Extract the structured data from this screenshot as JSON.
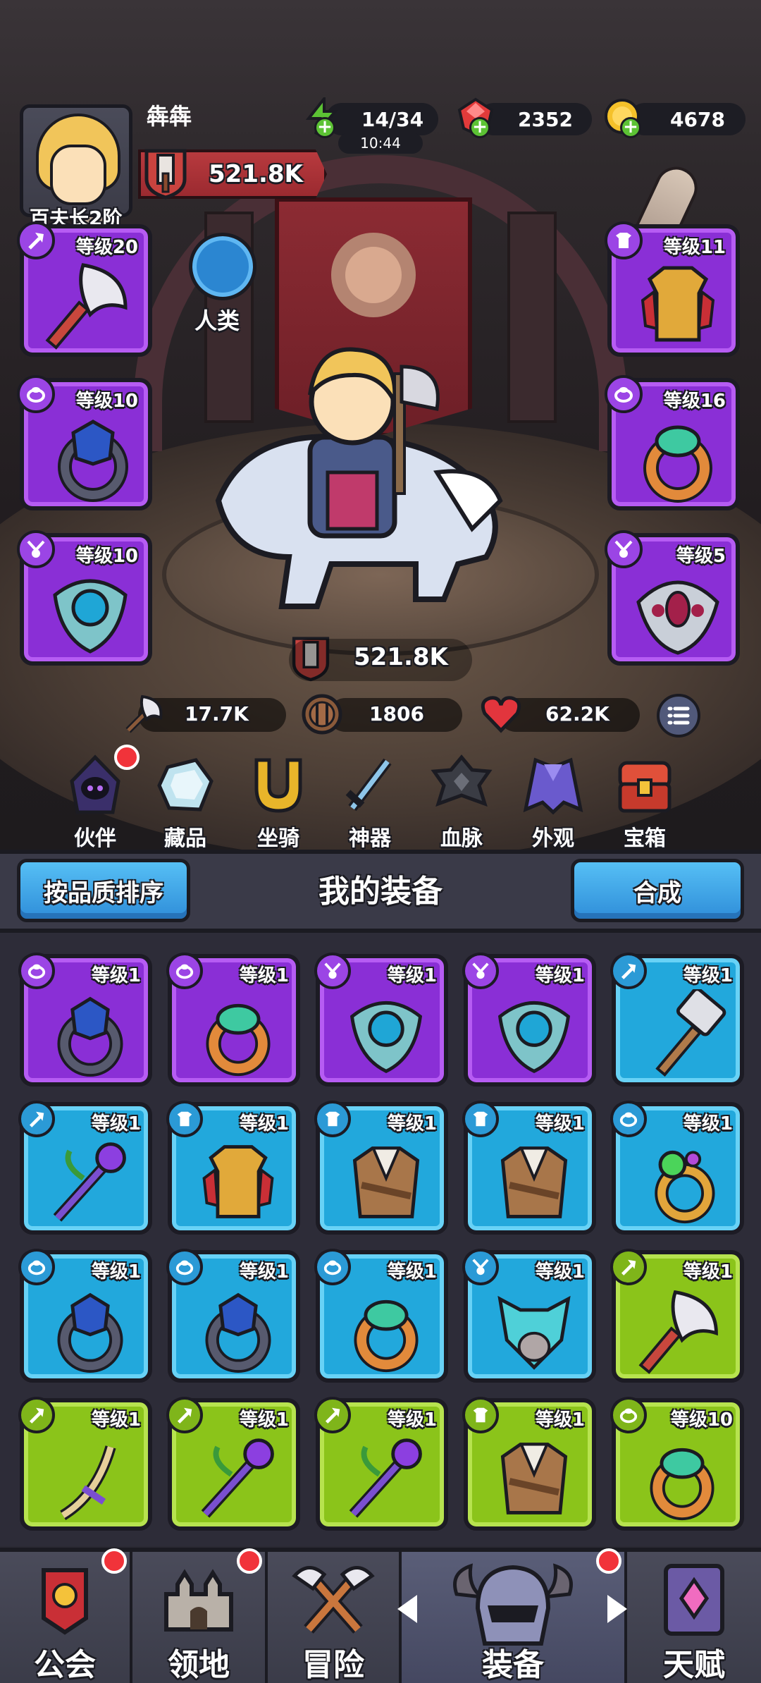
{
  "player": {
    "name": "犇犇",
    "rank": "百夫长2阶",
    "power": "521.8K"
  },
  "resources": {
    "energy": {
      "value": "14/34",
      "timer": "10:44",
      "color": "#5cc234"
    },
    "gems": {
      "value": "2352",
      "color": "#e23a3a"
    },
    "gold": {
      "value": "4678",
      "color": "#f5c12a"
    }
  },
  "race": {
    "label": "人类"
  },
  "equipped": {
    "weapon": {
      "level": "等级20",
      "icon": "axe-icon"
    },
    "armor": {
      "level": "等级11",
      "icon": "armor-icon"
    },
    "ring_left": {
      "level": "等级10",
      "icon": "ring-icon"
    },
    "ring_right": {
      "level": "等级16",
      "icon": "ring-icon"
    },
    "amulet_left": {
      "level": "等级10",
      "icon": "amulet-icon"
    },
    "amulet_right": {
      "level": "等级5",
      "icon": "amulet-icon"
    }
  },
  "hero_power": "521.8K",
  "stats": {
    "attack": "17.7K",
    "defense": "1806",
    "health": "62.2K"
  },
  "features": [
    {
      "label": "伙伴",
      "badge": true
    },
    {
      "label": "藏品",
      "badge": false
    },
    {
      "label": "坐骑",
      "badge": false
    },
    {
      "label": "神器",
      "badge": false
    },
    {
      "label": "血脉",
      "badge": false
    },
    {
      "label": "外观",
      "badge": false
    },
    {
      "label": "宝箱",
      "badge": false
    }
  ],
  "inventory": {
    "sort_label": "按品质排序",
    "title": "我的装备",
    "merge_label": "合成",
    "items": [
      {
        "level": "等级1",
        "rarity": "purple",
        "type": "ring",
        "art": "dark-ring"
      },
      {
        "level": "等级1",
        "rarity": "purple",
        "type": "ring",
        "art": "jade-ring"
      },
      {
        "level": "等级1",
        "rarity": "purple",
        "type": "amulet",
        "art": "blue-amulet"
      },
      {
        "level": "等级1",
        "rarity": "purple",
        "type": "amulet",
        "art": "blue-amulet"
      },
      {
        "level": "等级1",
        "rarity": "blue",
        "type": "weapon",
        "art": "hammer"
      },
      {
        "level": "等级1",
        "rarity": "blue",
        "type": "weapon",
        "art": "staff"
      },
      {
        "level": "等级1",
        "rarity": "blue",
        "type": "armor",
        "art": "gold-armor"
      },
      {
        "level": "等级1",
        "rarity": "blue",
        "type": "armor",
        "art": "leather-vest"
      },
      {
        "level": "等级1",
        "rarity": "blue",
        "type": "armor",
        "art": "leather-vest"
      },
      {
        "level": "等级1",
        "rarity": "blue",
        "type": "ring",
        "art": "green-ring"
      },
      {
        "level": "等级1",
        "rarity": "blue",
        "type": "ring",
        "art": "dark-ring"
      },
      {
        "level": "等级1",
        "rarity": "blue",
        "type": "ring",
        "art": "dark-ring"
      },
      {
        "level": "等级1",
        "rarity": "blue",
        "type": "ring",
        "art": "jade-ring"
      },
      {
        "level": "等级1",
        "rarity": "blue",
        "type": "amulet",
        "art": "skull-mask"
      },
      {
        "level": "等级1",
        "rarity": "green",
        "type": "weapon",
        "art": "axe"
      },
      {
        "level": "等级1",
        "rarity": "green",
        "type": "weapon",
        "art": "horn-staff"
      },
      {
        "level": "等级1",
        "rarity": "green",
        "type": "weapon",
        "art": "staff"
      },
      {
        "level": "等级1",
        "rarity": "green",
        "type": "weapon",
        "art": "staff"
      },
      {
        "level": "等级1",
        "rarity": "green",
        "type": "armor",
        "art": "leather-vest"
      },
      {
        "level": "等级10",
        "rarity": "green",
        "type": "ring",
        "art": "jade-ring"
      }
    ]
  },
  "bottom_nav": [
    {
      "label": "公会",
      "badge": true
    },
    {
      "label": "领地",
      "badge": true
    },
    {
      "label": "冒险",
      "badge": false
    },
    {
      "label": "装备",
      "badge": true,
      "active": true
    },
    {
      "label": "天赋",
      "badge": false
    }
  ]
}
